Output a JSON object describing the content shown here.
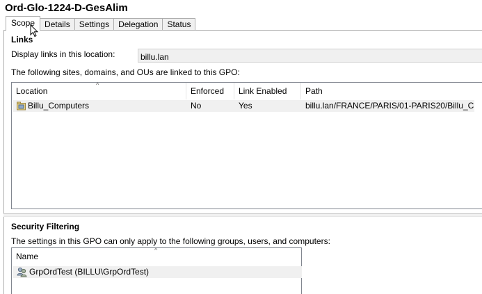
{
  "window": {
    "title": "Ord-Glo-1224-D-GesAlim"
  },
  "tabs": [
    {
      "label": "Scope"
    },
    {
      "label": "Details"
    },
    {
      "label": "Settings"
    },
    {
      "label": "Delegation"
    },
    {
      "label": "Status"
    }
  ],
  "active_tab": "Scope",
  "links": {
    "title": "Links",
    "display_label": "Display links in this location:",
    "location_value": "billu.lan",
    "linked_text": "The following sites, domains, and OUs are linked to this GPO:",
    "columns": {
      "location": "Location",
      "enforced": "Enforced",
      "link_enabled": "Link Enabled",
      "path": "Path"
    },
    "rows": [
      {
        "location": "Billu_Computers",
        "enforced": "No",
        "link_enabled": "Yes",
        "path": "billu.lan/FRANCE/PARIS/01-PARIS20/Billu_Co..."
      }
    ]
  },
  "security_filtering": {
    "title": "Security Filtering",
    "description": "The settings in this GPO can only apply to the following groups, users, and computers:",
    "columns": {
      "name": "Name"
    },
    "rows": [
      {
        "name": "GrpOrdTest (BILLU\\GrpOrdTest)"
      }
    ]
  },
  "icons": {
    "ou_row": "organizational-unit-icon",
    "group_row": "group-icon",
    "cursor": "mouse-pointer-icon"
  }
}
